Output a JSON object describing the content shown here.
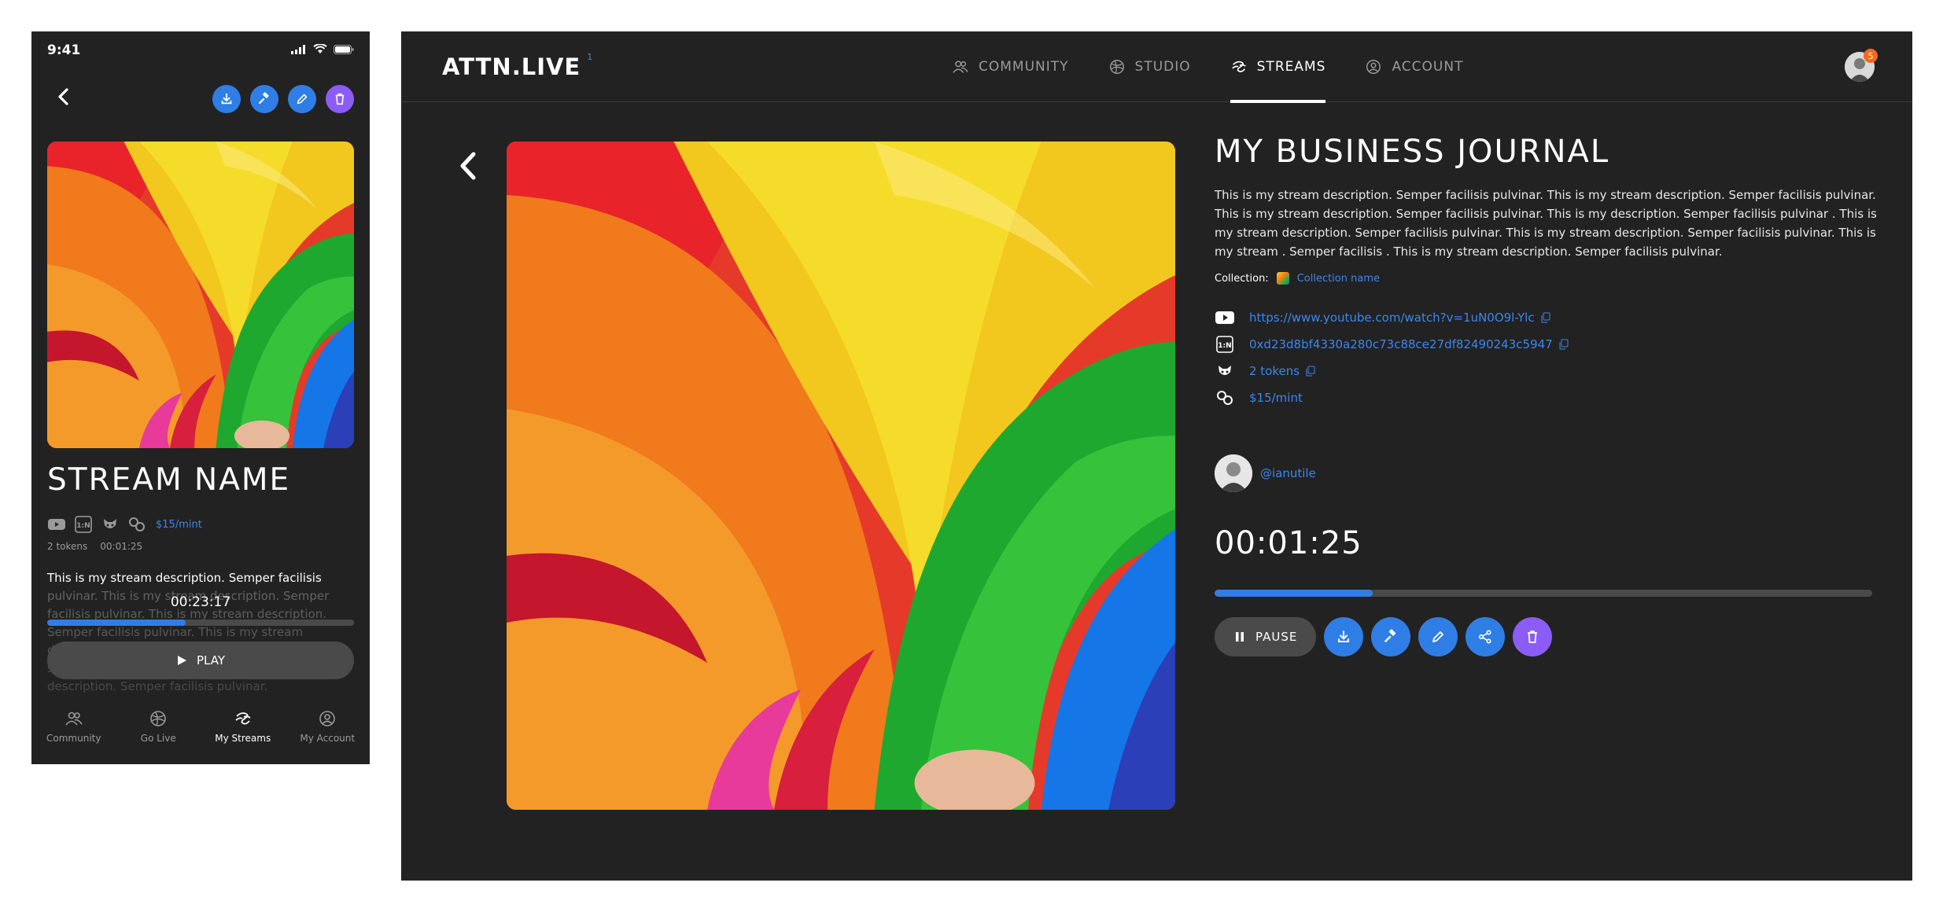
{
  "mobile": {
    "status": {
      "time": "9:41"
    },
    "title": "STREAM NAME",
    "price": "$15/mint",
    "tokens": "2 tokens",
    "duration": "00:01:25",
    "description": "This is my stream description. Semper facilisis pulvinar. This is my stream description. Semper facilisis pulvinar. This is my stream description. Semper facilisis pulvinar. This is my stream description. Semper facilisis pulvinar. This is my stream . Semper facilisis . This is my stream description. Semper facilisis pulvinar.",
    "current_time": "00:23:17",
    "progress": 0.45,
    "play_label": "PLAY",
    "tabs": [
      {
        "label": "Community",
        "icon": "community-icon"
      },
      {
        "label": "Go Live",
        "icon": "studio-icon"
      },
      {
        "label": "My Streams",
        "icon": "streams-icon"
      },
      {
        "label": "My Account",
        "icon": "account-icon"
      }
    ],
    "active_tab": "My Streams"
  },
  "desktop": {
    "logo": "ATTN.LIVE",
    "logo_sup": "1",
    "nav": [
      {
        "label": "COMMUNITY",
        "icon": "community-icon"
      },
      {
        "label": "STUDIO",
        "icon": "studio-icon"
      },
      {
        "label": "STREAMS",
        "icon": "streams-icon"
      },
      {
        "label": "ACCOUNT",
        "icon": "account-icon"
      }
    ],
    "active_nav": "STREAMS",
    "notification_count": "5",
    "title": "MY BUSINESS JOURNAL",
    "description": "This is my stream description. Semper facilisis pulvinar.  This is my stream description. Semper facilisis pulvinar. This is my stream description. Semper facilisis pulvinar.  This is my  description. Semper facilisis pulvinar . This is my stream description. Semper facilisis pulvinar.  This is my stream description. Semper facilisis pulvinar. This is my stream . Semper facilisis .  This is my stream description. Semper facilisis pulvinar.",
    "collection_label": "Collection:",
    "collection_name": "Collection name",
    "links": {
      "youtube": "https://www.youtube.com/watch?v=1uN0O9l-Ylc",
      "contract": "0xd23d8bf4330a280c73c88ce27df82490243c5947",
      "tokens": "2 tokens",
      "price": "$15/mint"
    },
    "author": "@ianutile",
    "current_time": "00:01:25",
    "progress": 0.24,
    "pause_label": "PAUSE"
  },
  "colors": {
    "background": "#222222",
    "accent_blue": "#2f7ee6",
    "accent_purple": "#8b5cf6",
    "link_blue": "#3b86f0",
    "badge_orange": "#f26b1d"
  }
}
